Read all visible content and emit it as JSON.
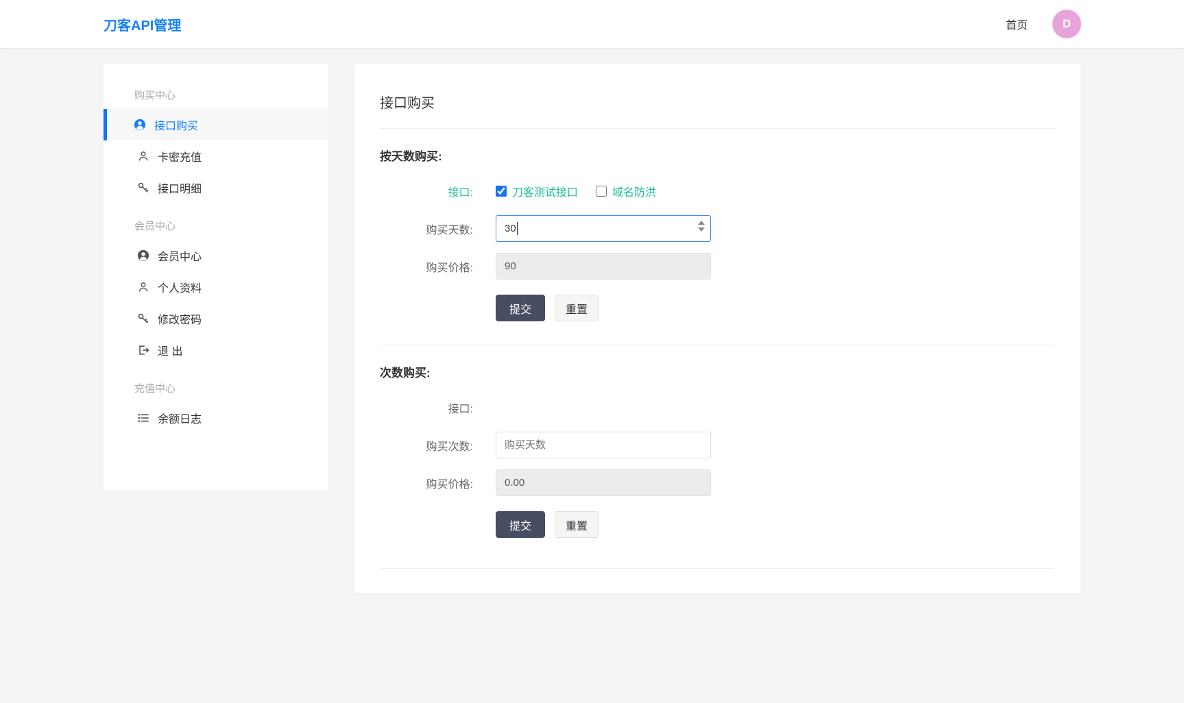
{
  "colors": {
    "brand_blue": "#1781f7",
    "active_border_blue": "#1673f0",
    "link_green": "#1abc9c",
    "submit_button": "#474d62",
    "avatar_pink": "#e8a3da",
    "page_background": "#f3f4f6"
  },
  "header": {
    "title": "刀客API管理",
    "home_link": "首页",
    "avatar_letter": "D"
  },
  "sidebar": {
    "sections": [
      {
        "title": "购买中心",
        "items": [
          {
            "label": "接口购买",
            "icon": "user-circle-icon",
            "active": true
          },
          {
            "label": "卡密充值",
            "icon": "user-outline-icon",
            "active": false
          },
          {
            "label": "接口明细",
            "icon": "key-icon",
            "active": false
          }
        ]
      },
      {
        "title": "会员中心",
        "items": [
          {
            "label": "会员中心",
            "icon": "user-circle-icon",
            "active": false
          },
          {
            "label": "个人资料",
            "icon": "user-outline-icon",
            "active": false
          },
          {
            "label": "修改密码",
            "icon": "key-icon",
            "active": false
          },
          {
            "label": "退 出",
            "icon": "logout-icon",
            "active": false
          }
        ]
      },
      {
        "title": "充值中心",
        "items": [
          {
            "label": "余额日志",
            "icon": "list-icon",
            "active": false
          }
        ]
      }
    ]
  },
  "main": {
    "title": "接口购买",
    "day_section": {
      "heading": "按天数购买:",
      "api_label": "接口:",
      "checkboxes": [
        {
          "label": "刀客测试接口",
          "checked": true
        },
        {
          "label": "域名防洪",
          "checked": false
        }
      ],
      "days_label": "购买天数:",
      "days_value": "30",
      "price_label": "购买价格:",
      "price_value": "90",
      "submit_label": "提交",
      "reset_label": "重置"
    },
    "count_section": {
      "heading": "次数购买:",
      "api_label": "接口:",
      "count_label": "购买次数:",
      "count_placeholder": "购买天数",
      "price_label": "购买价格:",
      "price_value": "0.00",
      "submit_label": "提交",
      "reset_label": "重置"
    }
  }
}
